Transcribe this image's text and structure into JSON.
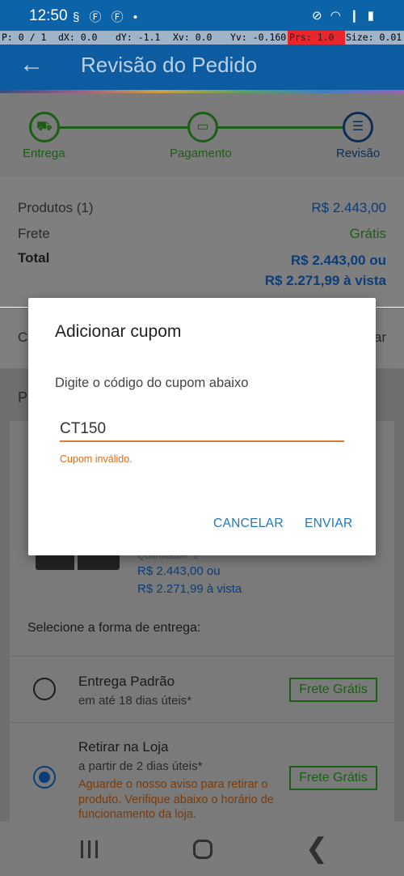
{
  "status_bar": {
    "time": "12:50",
    "left_icons": "§ Ⓕ Ⓕ •",
    "right_icons": "⊘ ◠ ❙ ▮"
  },
  "debug_overlay": {
    "p": "P: 0 / 1",
    "dx": "dX: 0.0",
    "dy": "dY: -1.1",
    "xv": "Xv: 0.0",
    "yv": "Yv: -0.160",
    "prs": "Prs: 1.0",
    "size": "Size: 0.01"
  },
  "app_bar": {
    "title": "Revisão do Pedido",
    "back_icon": "arrow-left-icon"
  },
  "stepper": {
    "steps": [
      {
        "label": "Entrega",
        "icon": "truck-icon",
        "glyph": "⛟"
      },
      {
        "label": "Pagamento",
        "icon": "card-icon",
        "glyph": "▭"
      },
      {
        "label": "Revisão",
        "icon": "list-icon",
        "glyph": "☰"
      }
    ]
  },
  "summary": {
    "products_label": "Produtos (1)",
    "products_value": "R$ 2.443,00",
    "freight_label": "Frete",
    "freight_value": "Grátis",
    "total_label": "Total",
    "total_value_1": "R$ 2.443,00 ou",
    "total_value_2": "R$ 2.271,99 à vista"
  },
  "coupon_row": {
    "left_fragment": "C",
    "right_fragment": "ar"
  },
  "products_section": {
    "heading_fragment": "P",
    "quantity_fragment": "Quantidade: 1",
    "price_line_1": "R$ 2.443,00 ou",
    "price_line_2": "R$ 2.271,99 à vista"
  },
  "delivery": {
    "title": "Selecione a forma de entrega:",
    "options": [
      {
        "title": "Entrega Padrão",
        "subtitle": "em até 18 dias úteis*",
        "badge": "Frete Grátis",
        "selected": false
      },
      {
        "title": "Retirar na Loja",
        "subtitle": "a partir de 2 dias úteis*",
        "warning": "Aguarde o nosso aviso para retirar o produto. Verifique abaixo o horário de funcionamento da loja.",
        "badge": "Frete Grátis",
        "selected": true
      }
    ]
  },
  "dialog": {
    "title": "Adicionar cupom",
    "message": "Digite o código do cupom abaixo",
    "input_value": "CT150",
    "error": "Cupom inválido.",
    "cancel_label": "CANCELAR",
    "send_label": "ENVIAR"
  },
  "nav_bar": {
    "recent_icon": "recent-apps-icon",
    "home_icon": "home-icon",
    "back_icon": "back-icon",
    "back_glyph": "❮"
  }
}
